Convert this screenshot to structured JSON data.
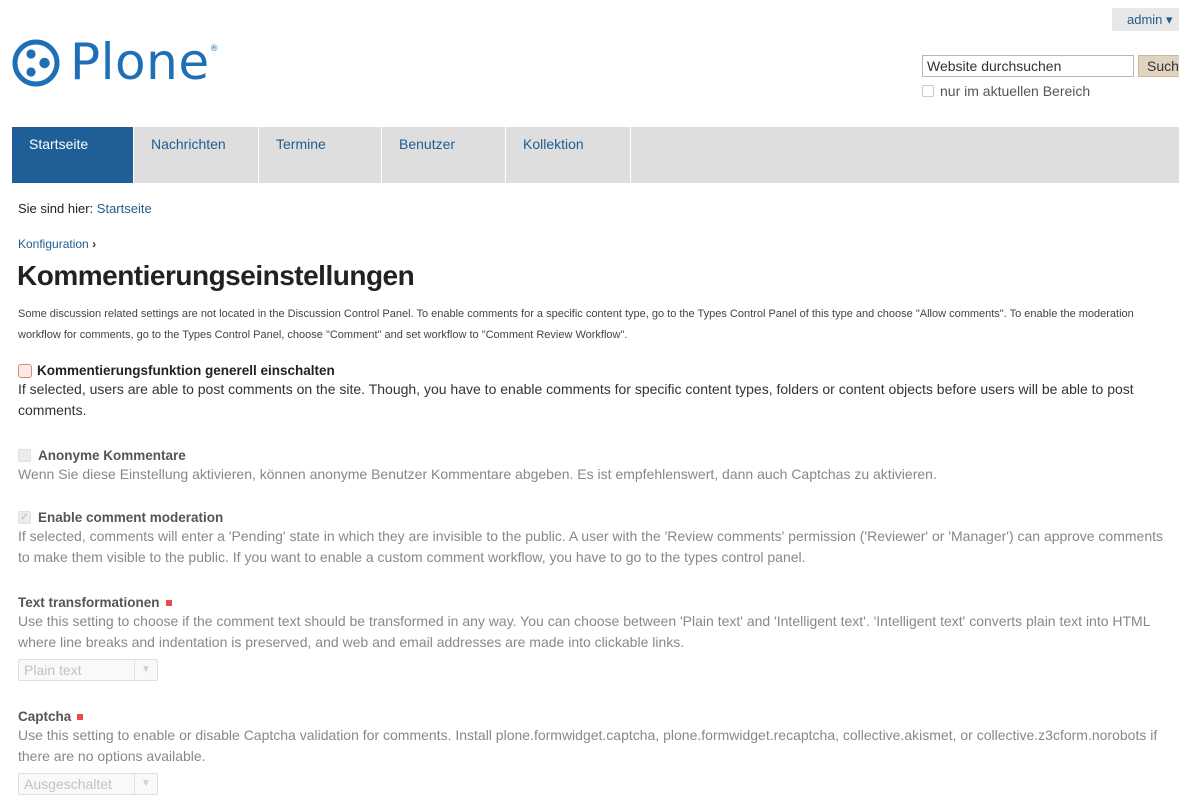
{
  "user_menu": {
    "label": "admin ▾"
  },
  "logo": {
    "text": "Plone",
    "reg": "®"
  },
  "search": {
    "value": "Website durchsuchen",
    "button_label": "Such",
    "scope_label": "nur im aktuellen Bereich"
  },
  "nav": {
    "tabs": [
      {
        "label": "Startseite",
        "active": true
      },
      {
        "label": "Nachrichten"
      },
      {
        "label": "Termine"
      },
      {
        "label": "Benutzer"
      },
      {
        "label": "Kollektion"
      }
    ]
  },
  "breadcrumb": {
    "prefix": "Sie sind hier:",
    "current": "Startseite"
  },
  "parent_link": {
    "label": "Konfiguration",
    "arrow": "›"
  },
  "page": {
    "title": "Kommentierungseinstellungen",
    "description": "Some discussion related settings are not located in the Discussion Control Panel. To enable comments for a specific content type, go to the Types Control Panel of this type and choose \"Allow comments\". To enable the moderation workflow for comments, go to the Types Control Panel, choose \"Comment\" and set workflow to \"Comment Review Workflow\"."
  },
  "fields": {
    "globally_enabled": {
      "label": "Kommentierungsfunktion generell einschalten",
      "help": "If selected, users are able to post comments on the site. Though, you have to enable comments for specific content types, folders or content objects before users will be able to post comments."
    },
    "anonymous": {
      "label": "Anonyme Kommentare",
      "help": "Wenn Sie diese Einstellung aktivieren, können anonyme Benutzer Kommentare abgeben. Es ist empfehlenswert, dann auch Captchas zu aktivieren."
    },
    "moderation": {
      "label": "Enable comment moderation",
      "help": "If selected, comments will enter a 'Pending' state in which they are invisible to the public. A user with the 'Review comments' permission ('Reviewer' or 'Manager') can approve comments to make them visible to the public. If you want to enable a custom comment workflow, you have to go to the types control panel."
    },
    "text_transform": {
      "label": "Text transformationen",
      "help": "Use this setting to choose if the comment text should be transformed in any way. You can choose between 'Plain text' and 'Intelligent text'. 'Intelligent text' converts plain text into HTML where line breaks and indentation is preserved, and web and email addresses are made into clickable links.",
      "selected": "Plain text"
    },
    "captcha": {
      "label": "Captcha",
      "help": "Use this setting to enable or disable Captcha validation for comments. Install plone.formwidget.captcha, plone.formwidget.recaptcha, collective.akismet, or collective.z3cform.norobots if there are no options available.",
      "selected": "Ausgeschaltet"
    }
  },
  "colors": {
    "brand": "#1f6fb6",
    "nav_active": "#1e5f98",
    "link": "#1f5d92",
    "required": "#e84c4c"
  }
}
